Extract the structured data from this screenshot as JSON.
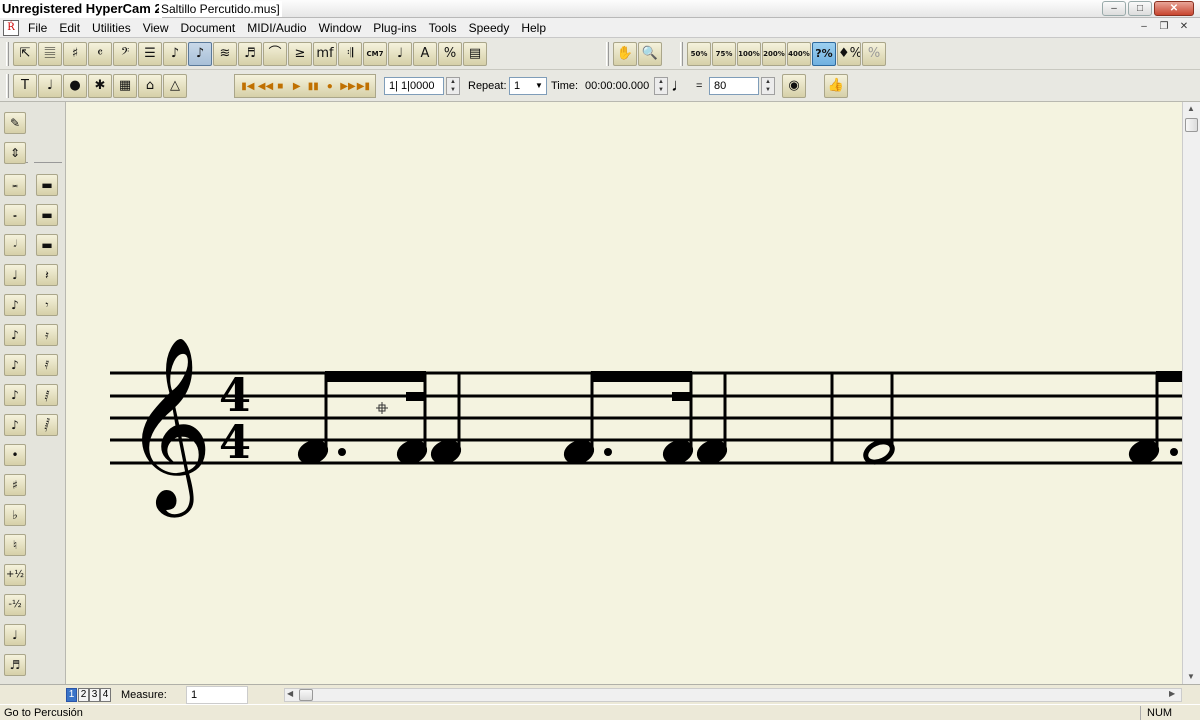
{
  "watermark": "Unregistered HyperCam 2",
  "document_title": "Saltillo Percutido.mus]",
  "app_icon": "Ŕ",
  "window_controls": [
    "–",
    "□",
    "✕"
  ],
  "mdi_controls": [
    "–",
    "❐",
    "✕"
  ],
  "menu": [
    "File",
    "Edit",
    "Utilities",
    "View",
    "Document",
    "MIDI/Audio",
    "Window",
    "Plug-ins",
    "Tools",
    "Speedy",
    "Help"
  ],
  "toolbar1": {
    "main_tools": [
      {
        "icon": "selection-tool-icon",
        "glyph": "⇱"
      },
      {
        "icon": "staff-tool-icon",
        "glyph": "𝄚"
      },
      {
        "icon": "key-signature-icon",
        "glyph": "♯"
      },
      {
        "icon": "time-signature-icon",
        "glyph": "𝄴"
      },
      {
        "icon": "clef-tool-icon",
        "glyph": "𝄢"
      },
      {
        "icon": "measure-tool-icon",
        "glyph": "☰"
      },
      {
        "icon": "simple-entry-icon",
        "glyph": "♪"
      },
      {
        "icon": "speedy-entry-icon",
        "glyph": "♪"
      },
      {
        "icon": "hyperscribe-icon",
        "glyph": "≋"
      },
      {
        "icon": "tuplet-tool-icon",
        "glyph": "♬"
      },
      {
        "icon": "smart-shape-icon",
        "glyph": "⌒"
      },
      {
        "icon": "articulation-tool-icon",
        "glyph": "≥"
      },
      {
        "icon": "expression-tool-icon",
        "glyph": "mf"
      },
      {
        "icon": "repeat-tool-icon",
        "glyph": "𝄇"
      },
      {
        "icon": "chord-tool-icon",
        "glyph": "CM7"
      },
      {
        "icon": "lyrics-tool-icon",
        "glyph": "♩"
      },
      {
        "icon": "text-tool-icon",
        "glyph": "A"
      },
      {
        "icon": "resize-tool-icon",
        "glyph": "%"
      },
      {
        "icon": "page-layout-icon",
        "glyph": "▤"
      }
    ],
    "nav_tools": [
      {
        "icon": "hand-grabber-icon",
        "glyph": "✋"
      },
      {
        "icon": "zoom-tool-icon",
        "glyph": "🔍"
      }
    ],
    "zoom_presets": [
      "50%",
      "75%",
      "100%",
      "200%",
      "400%"
    ],
    "zoom_custom": [
      "?%",
      "♦%",
      "%"
    ]
  },
  "toolbar2": {
    "tools": [
      {
        "icon": "mirror-tool-icon",
        "glyph": "T"
      },
      {
        "icon": "note-mover-icon",
        "glyph": "♩"
      },
      {
        "icon": "special-tools-icon",
        "glyph": "●"
      },
      {
        "icon": "ossia-tool-icon",
        "glyph": "✱"
      },
      {
        "icon": "graphics-tool-icon",
        "glyph": "▦"
      },
      {
        "icon": "midi-tool-icon",
        "glyph": "⌂"
      },
      {
        "icon": "tempo-tool-icon",
        "glyph": "△"
      }
    ],
    "transport": [
      "▮◀",
      "◀◀",
      "■",
      "▶",
      "▮▮",
      "●",
      "▶▶",
      "▶▮"
    ],
    "position_value": "1| 1|0000",
    "repeat_label": "Repeat:",
    "repeat_value": "1",
    "time_label": "Time:",
    "time_value": "00:00:00.000",
    "tempo_note": "♩",
    "equals": "=",
    "tempo_value": "80",
    "speaker_glyph": "◉",
    "thumb_glyph": "👍"
  },
  "palette_main": [
    {
      "icon": "pencil-icon",
      "glyph": "✎"
    },
    {
      "icon": "up-down-arrows-icon",
      "glyph": "⇕"
    }
  ],
  "palette_notes": [
    {
      "icon": "double-whole-note-icon",
      "glyph": "𝅜"
    },
    {
      "icon": "whole-note-icon",
      "glyph": "𝅝"
    },
    {
      "icon": "half-note-icon",
      "glyph": "𝅗𝅥"
    },
    {
      "icon": "quarter-note-icon",
      "glyph": "♩"
    },
    {
      "icon": "eighth-note-icon",
      "glyph": "♪"
    },
    {
      "icon": "sixteenth-note-icon",
      "glyph": "♪"
    },
    {
      "icon": "thirty-second-note-icon",
      "glyph": "♪"
    },
    {
      "icon": "sixty-fourth-note-icon",
      "glyph": "♪"
    },
    {
      "icon": "one-twenty-eighth-note-icon",
      "glyph": "♪"
    },
    {
      "icon": "dot-icon",
      "glyph": "•"
    },
    {
      "icon": "sharp-icon",
      "glyph": "♯"
    },
    {
      "icon": "flat-icon",
      "glyph": "♭"
    },
    {
      "icon": "natural-icon",
      "glyph": "♮"
    },
    {
      "icon": "half-step-up-icon",
      "glyph": "+½"
    },
    {
      "icon": "half-step-down-icon",
      "glyph": "-½"
    },
    {
      "icon": "tie-icon",
      "glyph": "♩"
    },
    {
      "icon": "tuplet-icon",
      "glyph": "♬"
    },
    {
      "icon": "grace-note-icon",
      "glyph": "♪"
    }
  ],
  "palette_rests": [
    {
      "icon": "double-whole-rest-icon",
      "glyph": "▬"
    },
    {
      "icon": "whole-rest-icon",
      "glyph": "▬"
    },
    {
      "icon": "half-rest-icon",
      "glyph": "▬"
    },
    {
      "icon": "quarter-rest-icon",
      "glyph": "𝄽"
    },
    {
      "icon": "eighth-rest-icon",
      "glyph": "𝄾"
    },
    {
      "icon": "sixteenth-rest-icon",
      "glyph": "𝄿"
    },
    {
      "icon": "thirty-second-rest-icon",
      "glyph": "𝅀"
    },
    {
      "icon": "sixty-fourth-rest-icon",
      "glyph": "𝅁"
    },
    {
      "icon": "one-twenty-eighth-rest-icon",
      "glyph": "𝅂"
    }
  ],
  "score": {
    "time_signature_top": "4",
    "time_signature_bottom": "4"
  },
  "layers": [
    "1",
    "2",
    "3",
    "4"
  ],
  "measure_label": "Measure:",
  "measure_value": "1",
  "status_text": "Go to Percusión",
  "status_num": "NUM"
}
